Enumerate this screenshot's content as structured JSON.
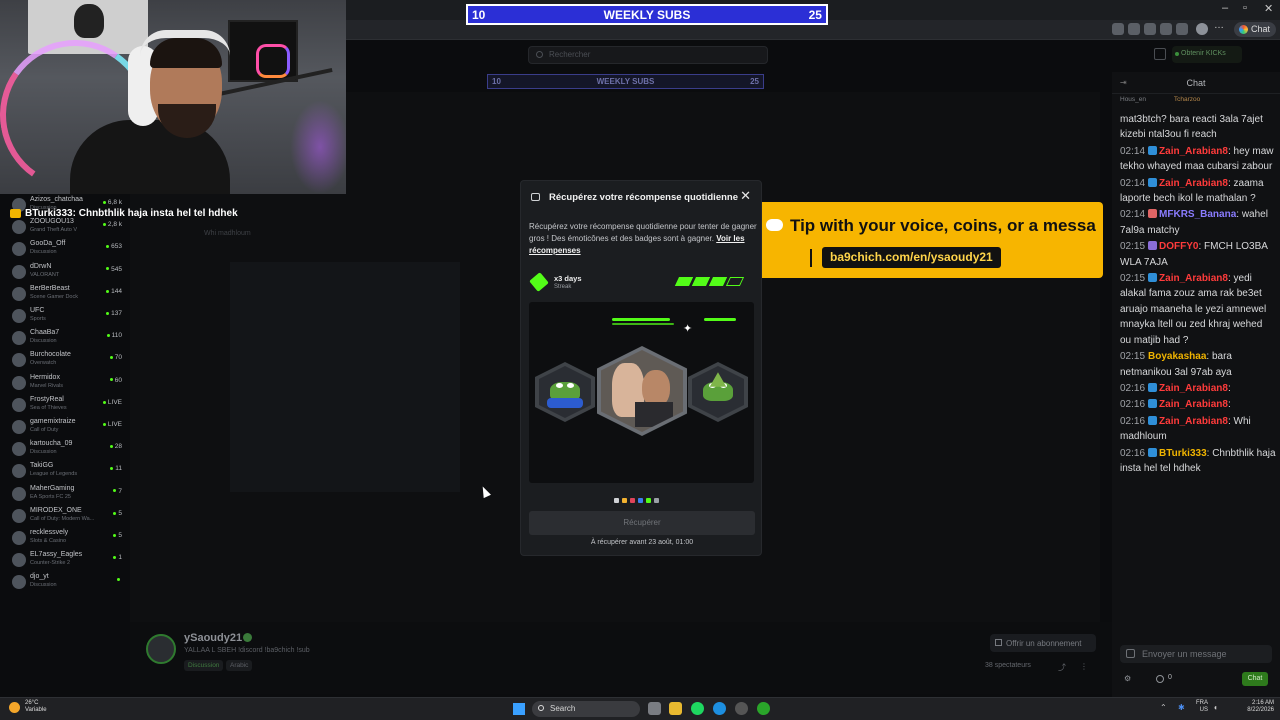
{
  "overlay_subs": {
    "left": "10",
    "title": "WEEKLY SUBS",
    "right": "25"
  },
  "overlay_subs_mirror": {
    "left": "10",
    "title": "WEEKLY SUBS",
    "right": "25"
  },
  "browser": {
    "chat_pill": "Chat"
  },
  "kick_header": {
    "search_placeholder": "Rechercher",
    "kick_button": "Obtenir KICKs"
  },
  "cam_message": {
    "user": "BTurki333",
    "text": " : Chnbthlik haja insta hel tel hdhek"
  },
  "sidebar": {
    "items": [
      {
        "name": "Azizos_chatchaa",
        "sub": "Discussion",
        "count": "6,8 k"
      },
      {
        "name": "ZOOUGOU13",
        "sub": "Grand Theft Auto V",
        "count": "2,8 k"
      },
      {
        "name": "GooDa_Off",
        "sub": "Discussion",
        "count": "653"
      },
      {
        "name": "dDrwN",
        "sub": "VALORANT",
        "count": "545"
      },
      {
        "name": "BerBerBeast",
        "sub": "Scene Gamer Dock",
        "count": "144"
      },
      {
        "name": "UFC",
        "sub": "Sports",
        "count": "137"
      },
      {
        "name": "ChaaBa7",
        "sub": "Discussion",
        "count": "110"
      },
      {
        "name": "Burchocolate",
        "sub": "Overwatch",
        "count": "70"
      },
      {
        "name": "Hermidox",
        "sub": "Marvel Rivals",
        "count": "60"
      },
      {
        "name": "FrostyReal",
        "sub": "Sea of Thieves",
        "count": "LIVE"
      },
      {
        "name": "gamemixtraize",
        "sub": "Call of Duty",
        "count": "LIVE"
      },
      {
        "name": "kartoucha_09",
        "sub": "Discussion",
        "count": "28"
      },
      {
        "name": "TakiGG",
        "sub": "League of Legends",
        "count": "11"
      },
      {
        "name": "MaherGaming",
        "sub": "EA Sports FC 25",
        "count": "7"
      },
      {
        "name": "MIRODEX_ONE",
        "sub": "Call of Duty: Modern Wa...",
        "count": "5"
      },
      {
        "name": "recklessvely",
        "sub": "Slots & Casino",
        "count": "5"
      },
      {
        "name": "EL7assy_Eagles",
        "sub": "Counter-Strike 2",
        "count": "1"
      },
      {
        "name": "djo_yt",
        "sub": "Discussion",
        "count": ""
      }
    ]
  },
  "main_video": {
    "caption": "Whi madhloum"
  },
  "streamer": {
    "name": "ySaoudy21",
    "title": "YALLAA L SBEH   !discord !ba9chich !sub",
    "tags": [
      "Discussion",
      "Arabic"
    ],
    "subscribe_label": "Offrir un abonnement",
    "viewers": "38 spectateurs"
  },
  "tip_overlay": {
    "text": "Tip with your voice, coins, or a messa",
    "link": "ba9chich.com/en/ysaoudy21"
  },
  "modal": {
    "title": "Récupérez votre récompense quotidienne",
    "desc": "Récupérez votre récompense quotidienne pour tenter de gagner gros ! Des émoticônes et des badges sont à gagner. ",
    "desc_link": "Voir les récompenses",
    "streak_days": "x3 days",
    "streak_label": "Streak",
    "claim_button": "Récupérer",
    "footer": "À récupérer avant 23 août, 01:00",
    "segments_filled": 3,
    "segments_total": 4,
    "dot_colors": [
      "#cfd1d4",
      "#f2b230",
      "#e0445a",
      "#3c7df0",
      "#53fc18",
      "#9aa0a6"
    ]
  },
  "chat": {
    "header": "Chat",
    "pinned": [
      "Hous_en",
      "Tcharzoo"
    ],
    "messages": [
      {
        "time": "",
        "user": "",
        "color": "#d8d9db",
        "text": "mat3btch? bara reacti 3ala 7ajet kizebi ntal3ou fi reach",
        "badge": ""
      },
      {
        "time": "02:14",
        "user": "Zain_Arabian8",
        "color": "#ff3b3b",
        "text": ": hey maw tekho whayed maa cubarsi zabour",
        "badge": "#2f8fd8"
      },
      {
        "time": "02:14",
        "user": "Zain_Arabian8",
        "color": "#ff3b3b",
        "text": ": zaama laporte bech ikol le mathalan ?",
        "badge": "#2f8fd8"
      },
      {
        "time": "02:14",
        "user": "MFKRS_Banana",
        "color": "#8a7cff",
        "text": ": wahel 7al9a matchy",
        "badge": "#e06565"
      },
      {
        "time": "02:15",
        "user": "DOFFY0",
        "color": "#ff3b3b",
        "text": ": FMCH LO3BA WLA 7AJA",
        "badge": "#8a6dd8"
      },
      {
        "time": "02:15",
        "user": "Zain_Arabian8",
        "color": "#ff3b3b",
        "text": ": yedi alakal fama zouz ama rak be3et aruajo maaneha le yezi amnewel mnayka ltell ou zed khraj wehed ou matjib had ?",
        "badge": "#2f8fd8"
      },
      {
        "time": "02:15",
        "user": "Boyakashaa",
        "color": "#f0b400",
        "text": ": bara netmanikou 3al 97ab aya",
        "badge": ""
      },
      {
        "time": "02:16",
        "user": "Zain_Arabian8",
        "color": "#ff3b3b",
        "text": ":",
        "badge": "#2f8fd8"
      },
      {
        "time": "02:16",
        "user": "Zain_Arabian8",
        "color": "#ff3b3b",
        "text": ":",
        "badge": "#2f8fd8"
      },
      {
        "time": "02:16",
        "user": "Zain_Arabian8",
        "color": "#ff3b3b",
        "text": ": Whi madhloum",
        "badge": "#2f8fd8"
      },
      {
        "time": "02:16",
        "user": "BTurki333",
        "color": "#f0b400",
        "text": ": Chnbthlik haja insta hel tel hdhek",
        "badge": "#2f8fd8"
      }
    ],
    "input_placeholder": "Envoyer un message",
    "send_label": "Chat",
    "points": "0"
  },
  "taskbar": {
    "weather_temp": "26°C",
    "weather_desc": "Variable",
    "search_label": "Search",
    "lang": "FRA",
    "region": "US",
    "time": "2:16 AM",
    "date": "8/22/2026"
  }
}
